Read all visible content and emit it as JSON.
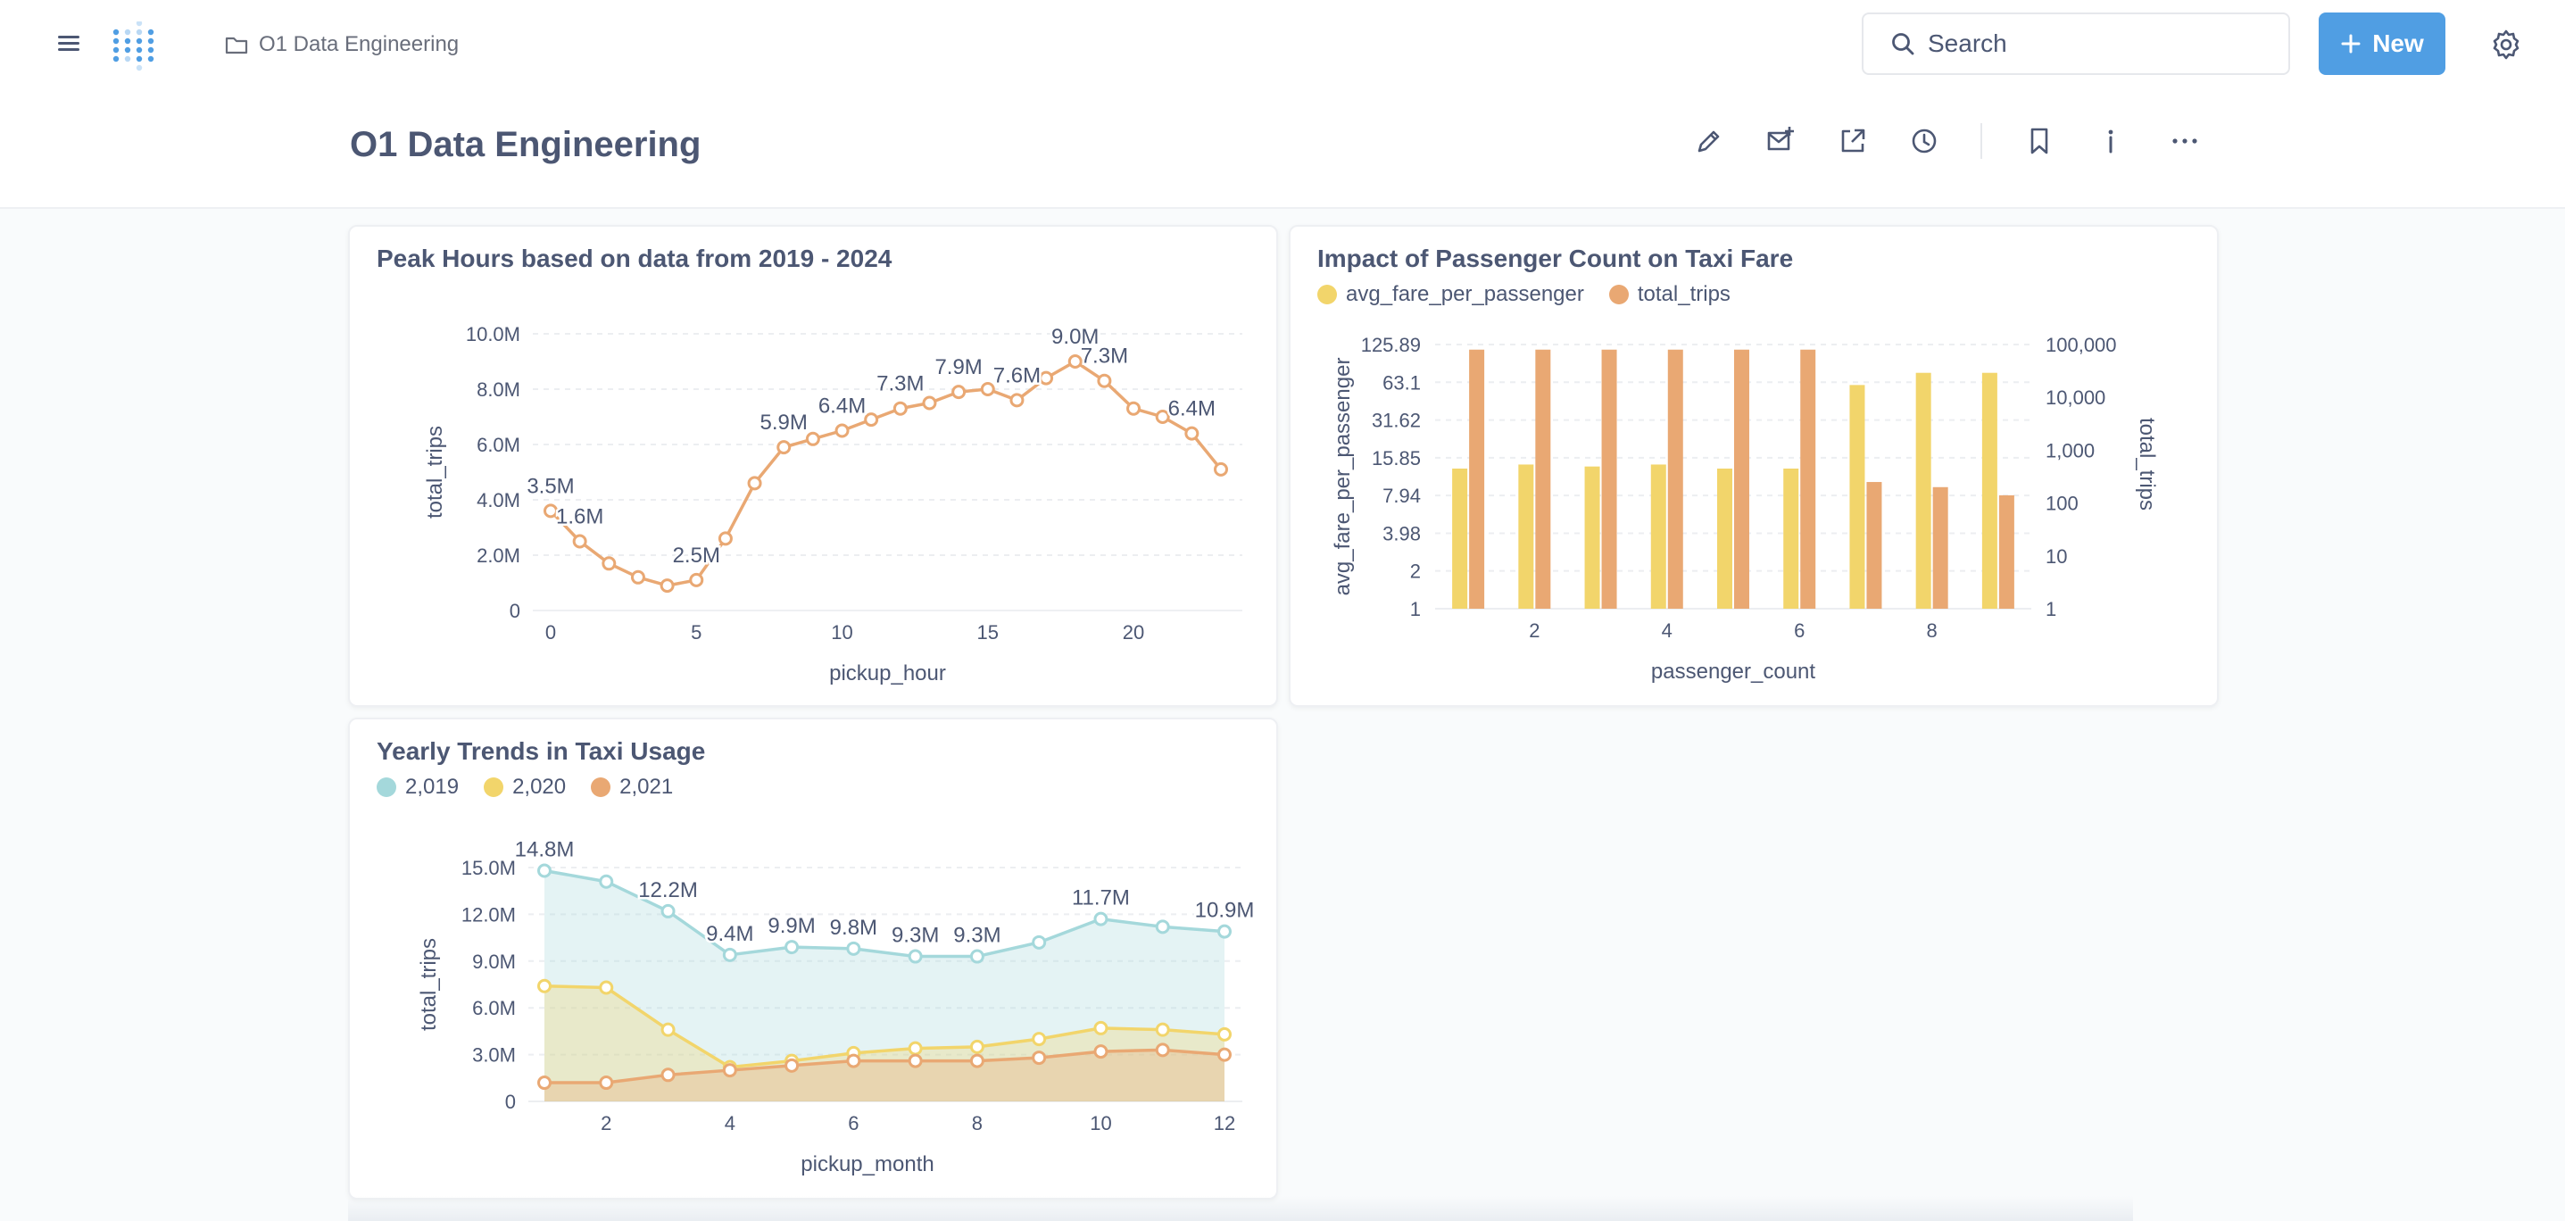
{
  "topbar": {
    "breadcrumb": "O1 Data Engineering",
    "search_label": "Search",
    "new_label": "New"
  },
  "header": {
    "title": "O1 Data Engineering",
    "actions": [
      "pencil-icon",
      "subscription-icon",
      "share-icon",
      "history-icon",
      "bookmark-icon",
      "info-icon",
      "more-icon"
    ]
  },
  "colors": {
    "accent": "#509ee3",
    "orange": "#e9a873",
    "yellow": "#f2d56b",
    "teal": "#a4d8db"
  },
  "chart_data": [
    {
      "type": "line",
      "title": "Peak Hours based on data from 2019 - 2024",
      "xlabel": "pickup_hour",
      "ylabel": "total_trips",
      "x": [
        0,
        1,
        2,
        3,
        4,
        5,
        6,
        7,
        8,
        9,
        10,
        11,
        12,
        13,
        14,
        15,
        16,
        17,
        18,
        19,
        20,
        21,
        22,
        23
      ],
      "values": [
        3.6,
        2.5,
        1.7,
        1.2,
        0.9,
        1.1,
        2.6,
        4.6,
        5.9,
        6.2,
        6.5,
        6.9,
        7.3,
        7.5,
        7.9,
        8.0,
        7.6,
        8.4,
        9.0,
        8.3,
        7.3,
        7.0,
        6.4,
        5.1
      ],
      "point_labels": [
        "3.5M",
        "1.6M",
        "",
        "",
        "",
        "2.5M",
        "",
        "",
        "5.9M",
        "",
        "6.4M",
        "",
        "7.3M",
        "",
        "7.9M",
        "",
        "7.6M",
        "",
        "9.0M",
        "7.3M",
        "",
        "",
        "6.4M",
        ""
      ],
      "label_index": [
        0,
        1,
        null,
        null,
        null,
        6,
        null,
        null,
        8,
        null,
        10,
        null,
        12,
        null,
        14,
        null,
        16,
        null,
        18,
        19,
        null,
        null,
        22,
        null
      ],
      "ylim": [
        0,
        10
      ],
      "yticks": [
        "0",
        "2.0M",
        "4.0M",
        "6.0M",
        "8.0M",
        "10.0M"
      ],
      "xticks": [
        "0",
        "5",
        "10",
        "15",
        "20"
      ],
      "color": "#e9a873"
    },
    {
      "type": "bar",
      "title": "Impact of Passenger Count on Taxi Fare",
      "xlabel": "passenger_count",
      "ylabel_left": "avg_fare_per_passenger",
      "ylabel_right": "total_trips",
      "categories": [
        1,
        2,
        3,
        4,
        5,
        6,
        7,
        8,
        9
      ],
      "xticks": [
        "2",
        "4",
        "6",
        "8"
      ],
      "series": [
        {
          "name": "avg_fare_per_passenger",
          "color": "#f2d56b",
          "axis": "left",
          "values": [
            13,
            14,
            13.5,
            14,
            13,
            13,
            60,
            75,
            75
          ]
        },
        {
          "name": "total_trips",
          "color": "#e9a873",
          "axis": "right",
          "values": [
            80000,
            80000,
            80000,
            80000,
            80000,
            80000,
            250,
            200,
            140
          ]
        }
      ],
      "yticks_left": [
        "1",
        "2",
        "3.98",
        "7.94",
        "15.85",
        "31.62",
        "63.1",
        "125.89"
      ],
      "yticks_right": [
        "1",
        "10",
        "100",
        "1,000",
        "10,000",
        "100,000"
      ],
      "scale": "log",
      "ylim_left": [
        1,
        125.89
      ],
      "ylim_right": [
        1,
        100000
      ]
    },
    {
      "type": "area",
      "title": "Yearly Trends in Taxi Usage",
      "xlabel": "pickup_month",
      "ylabel": "total_trips",
      "x": [
        1,
        2,
        3,
        4,
        5,
        6,
        7,
        8,
        9,
        10,
        11,
        12
      ],
      "xticks": [
        "2",
        "4",
        "6",
        "8",
        "10",
        "12"
      ],
      "yticks": [
        "0",
        "3.0M",
        "6.0M",
        "9.0M",
        "12.0M",
        "15.0M"
      ],
      "ylim": [
        0,
        15
      ],
      "series": [
        {
          "name": "2,019",
          "color": "#a4d8db",
          "values": [
            14.8,
            14.1,
            12.2,
            9.4,
            9.9,
            9.8,
            9.3,
            9.3,
            10.2,
            11.7,
            11.2,
            10.9
          ],
          "point_labels": [
            "14.8M",
            "",
            "12.2M",
            "9.4M",
            "9.9M",
            "9.8M",
            "9.3M",
            "9.3M",
            "",
            "11.7M",
            "",
            "10.9M"
          ]
        },
        {
          "name": "2,020",
          "color": "#f2d56b",
          "values": [
            7.4,
            7.3,
            4.6,
            2.2,
            2.6,
            3.1,
            3.4,
            3.5,
            4.0,
            4.7,
            4.6,
            4.3
          ]
        },
        {
          "name": "2,021",
          "color": "#e9a873",
          "values": [
            1.2,
            1.2,
            1.7,
            2.0,
            2.3,
            2.6,
            2.6,
            2.6,
            2.8,
            3.2,
            3.3,
            3.0
          ]
        }
      ]
    }
  ]
}
